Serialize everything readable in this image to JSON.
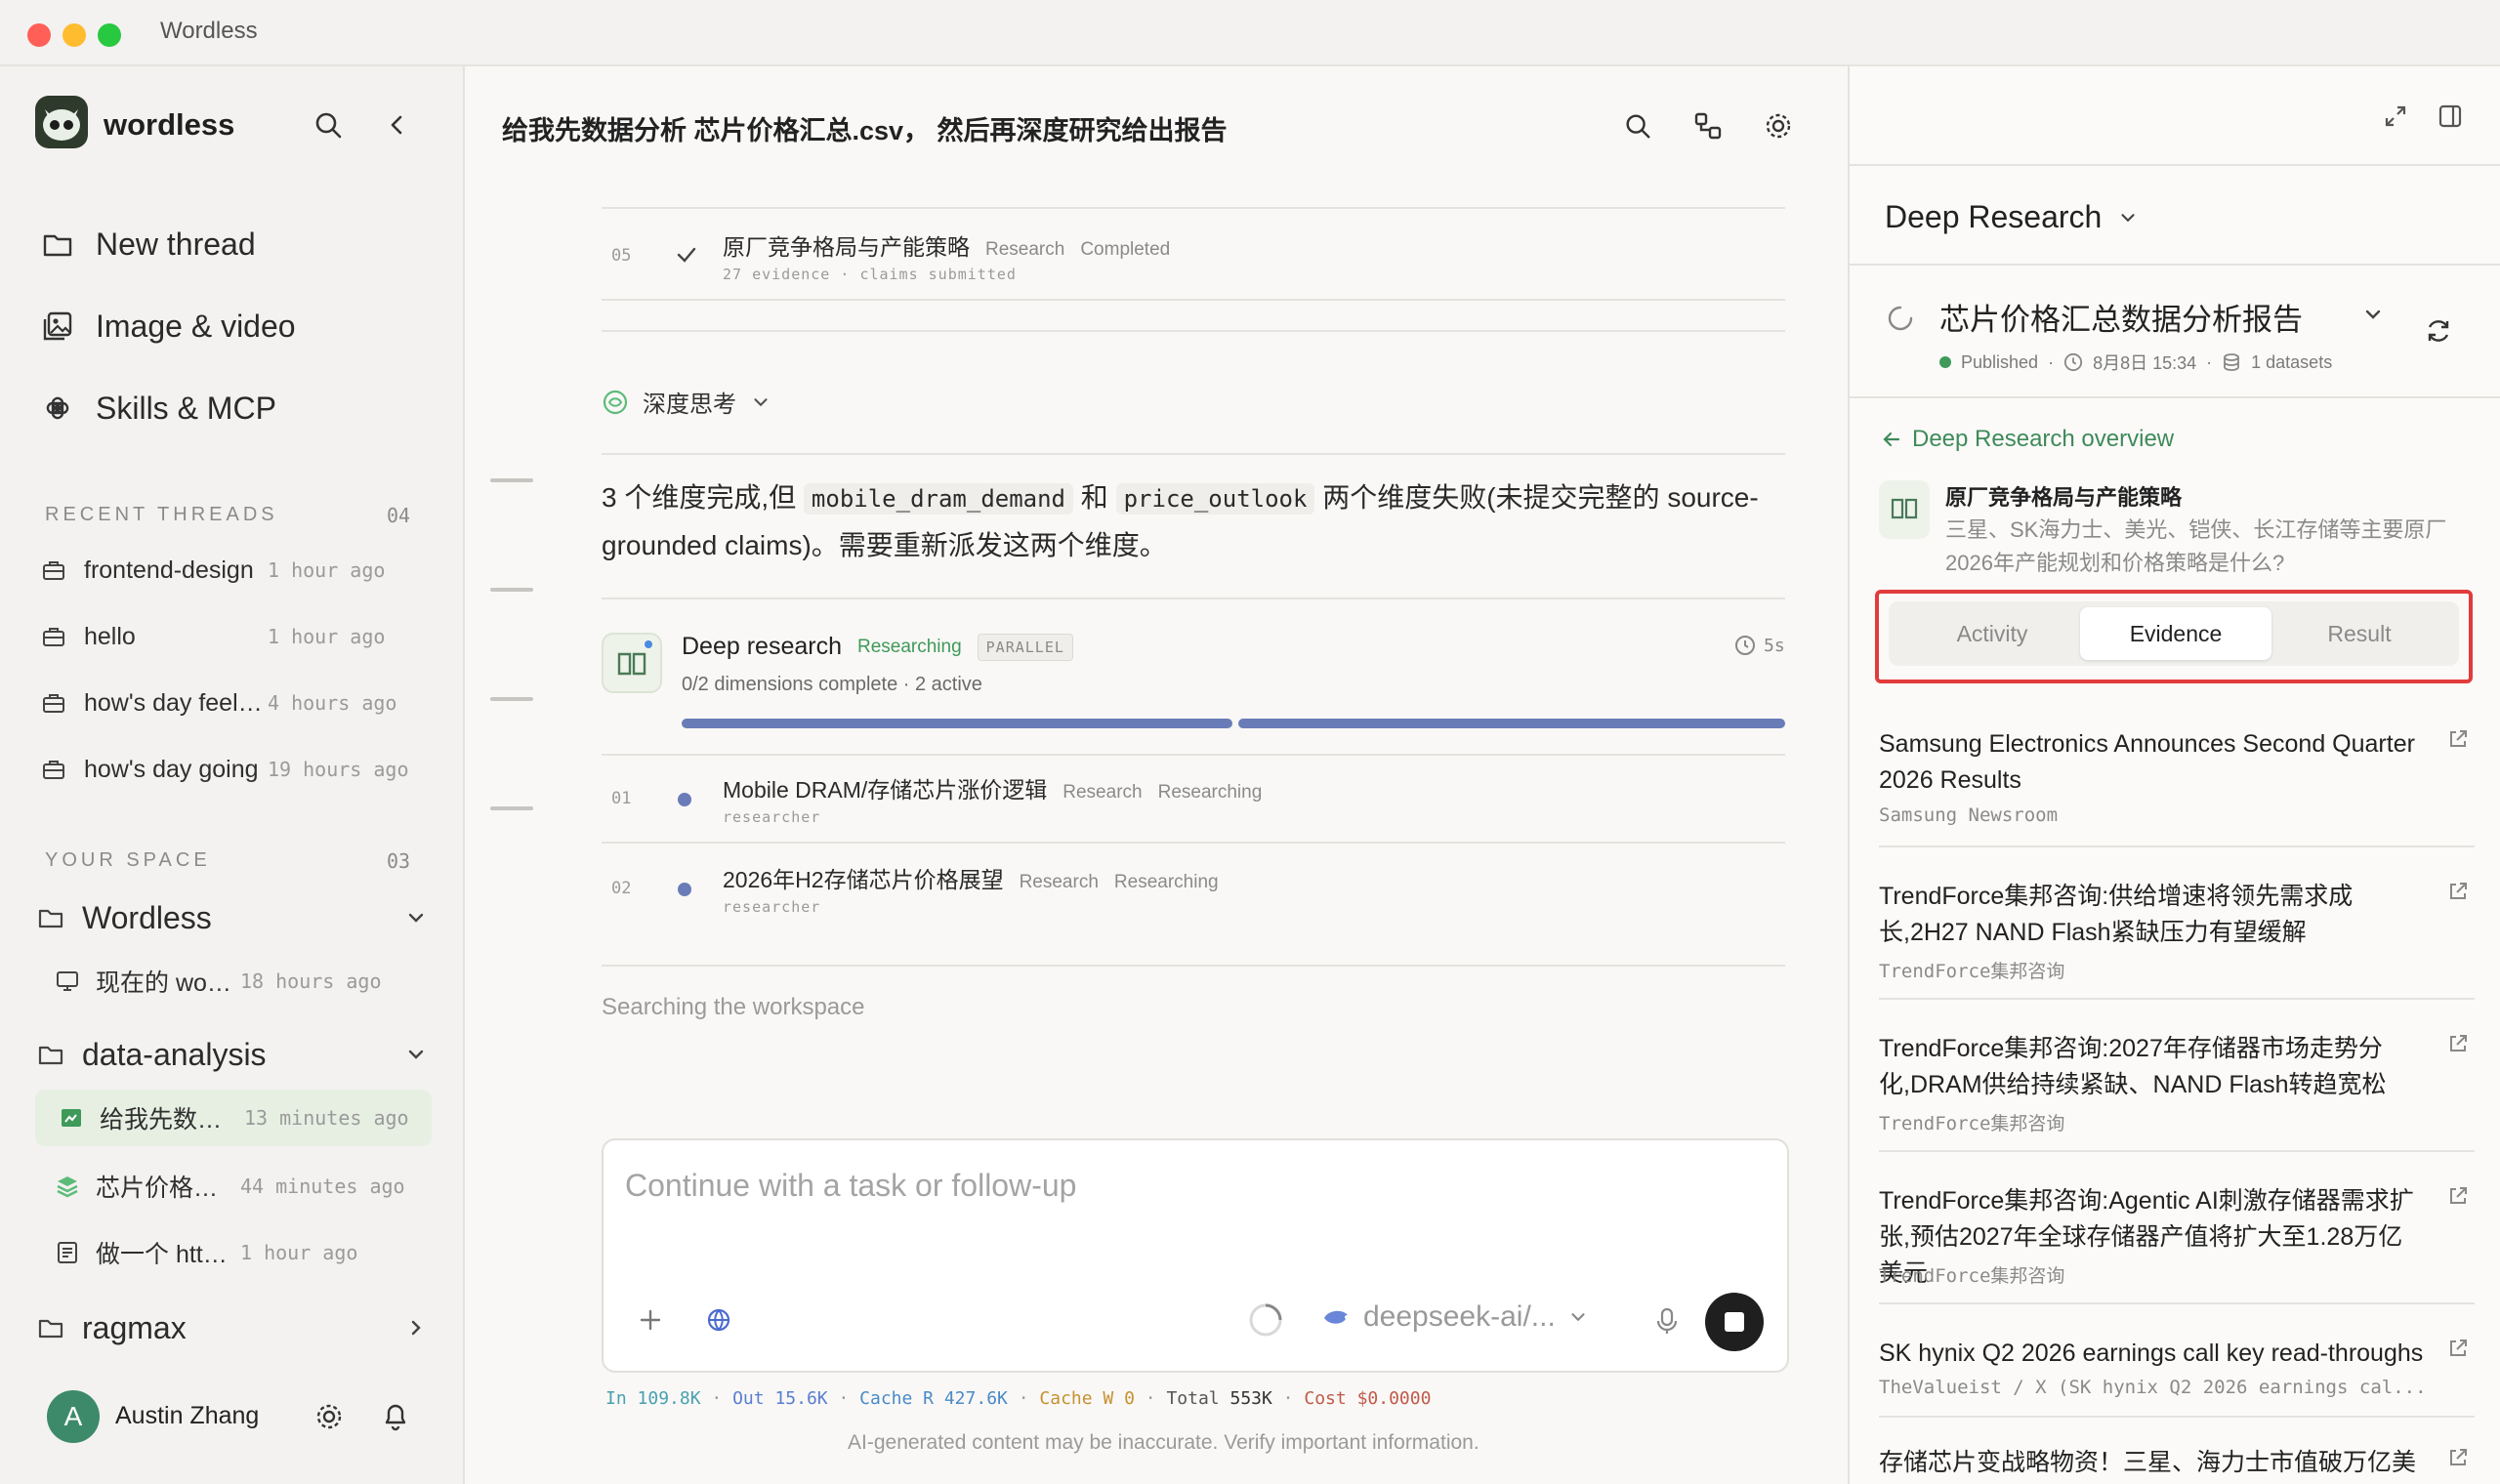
{
  "window": {
    "title": "Wordless"
  },
  "sidebar": {
    "brand": "wordless",
    "nav": [
      {
        "label": "New thread",
        "icon": "folder-icon"
      },
      {
        "label": "Image & video",
        "icon": "image-icon"
      },
      {
        "label": "Skills & MCP",
        "icon": "command-icon"
      }
    ],
    "recent": {
      "title": "RECENT THREADS",
      "count": "04",
      "items": [
        {
          "title": "frontend-design",
          "time": "1 hour ago"
        },
        {
          "title": "hello",
          "time": "1 hour ago"
        },
        {
          "title": "how's day feeling",
          "time": "4 hours ago"
        },
        {
          "title": "how's day going",
          "time": "19 hours ago"
        }
      ]
    },
    "space": {
      "title": "YOUR SPACE",
      "count": "03",
      "folders": [
        {
          "name": "Wordless",
          "items": [
            {
              "title": "现在的 workspace",
              "time": "18 hours ago"
            }
          ]
        },
        {
          "name": "data-analysis",
          "items": [
            {
              "title": "给我先数据分析",
              "time": "13 minutes ago"
            },
            {
              "title": "芯片价格汇总",
              "time": "44 minutes ago"
            },
            {
              "title": "做一个 https://...",
              "time": "1 hour ago"
            }
          ]
        },
        {
          "name": "ragmax"
        }
      ]
    },
    "user": {
      "initial": "A",
      "name": "Austin Zhang"
    }
  },
  "main": {
    "title": "给我先数据分析 芯片价格汇总.csv， 然后再深度研究给出报告",
    "step05": {
      "num": "05",
      "title": "原厂竞争格局与产能策略",
      "tag": "Research",
      "status": "Completed",
      "evidence": "27 evidence",
      "claims": "claims submitted"
    },
    "thinking": {
      "label": "深度思考"
    },
    "message": {
      "p1": "3 个维度完成,但",
      "code1": "mobile_dram_demand",
      "p2": "和",
      "code2": "price_outlook",
      "p3": "两个维度失败(未提交完整的 source-grounded claims)。需要重新派发这两个维度。"
    },
    "deep": {
      "title": "Deep research",
      "status": "Researching",
      "badge": "PARALLEL",
      "timer": "5s",
      "progress_text": "0/2 dimensions complete · 2 active",
      "progress": [
        1,
        1
      ]
    },
    "dims": [
      {
        "num": "01",
        "title": "Mobile DRAM/存储芯片涨价逻辑",
        "tag": "Research",
        "status": "Researching",
        "sub": "researcher"
      },
      {
        "num": "02",
        "title": "2026年H2存储芯片价格展望",
        "tag": "Research",
        "status": "Researching",
        "sub": "researcher"
      }
    ],
    "searching": "Searching the workspace",
    "composer": {
      "placeholder": "Continue with a task or follow-up",
      "model": "deepseek-ai/..."
    },
    "usage": {
      "in_label": "In",
      "in": "109.8K",
      "out_label": "Out",
      "out": "15.6K",
      "cache_r_label": "Cache R",
      "cache_r": "427.6K",
      "cache_w_label": "Cache W",
      "cache_w": "0",
      "total_label": "Total",
      "total": "553K",
      "cost_label": "Cost",
      "cost": "$0.0000"
    },
    "disclaimer": "AI-generated content may be inaccurate. Verify important information."
  },
  "panel": {
    "mode": "Deep Research",
    "report": {
      "title": "芯片价格汇总数据分析报告",
      "status": "Published",
      "date": "8月8日 15:34",
      "datasets": "1 datasets"
    },
    "back": "Deep Research overview",
    "dimension": {
      "title": "原厂竞争格局与产能策略",
      "question": "三星、SK海力士、美光、铠侠、长江存储等主要原厂2026年产能规划和价格策略是什么?"
    },
    "tabs": [
      {
        "label": "Activity",
        "active": false
      },
      {
        "label": "Evidence",
        "active": true
      },
      {
        "label": "Result",
        "active": false
      }
    ],
    "sources": [
      {
        "title": "Samsung Electronics Announces Second Quarter 2026 Results",
        "source": "Samsung Newsroom"
      },
      {
        "title": "TrendForce集邦咨询:供给增速将领先需求成长,2H27 NAND Flash紧缺压力有望缓解",
        "source": "TrendForce集邦咨询"
      },
      {
        "title": "TrendForce集邦咨询:2027年存储器市场走势分化,DRAM供给持续紧缺、NAND Flash转趋宽松",
        "source": "TrendForce集邦咨询"
      },
      {
        "title": "TrendForce集邦咨询:Agentic AI刺激存储器需求扩张,预估2027年全球存储器产值将扩大至1.28万亿美元",
        "source": "TrendForce集邦咨询"
      },
      {
        "title": "SK hynix Q2 2026 earnings call key read-throughs",
        "source": "TheValueist / X (SK hynix Q2 2026 earnings cal..."
      },
      {
        "title": "存储芯片变战略物资！三星、海力士市值破万亿美元",
        "source": ""
      }
    ]
  },
  "colors": {
    "accent_green": "#3f9a5a",
    "progress": "#6a7cb8",
    "highlight": "#e23b3b"
  }
}
